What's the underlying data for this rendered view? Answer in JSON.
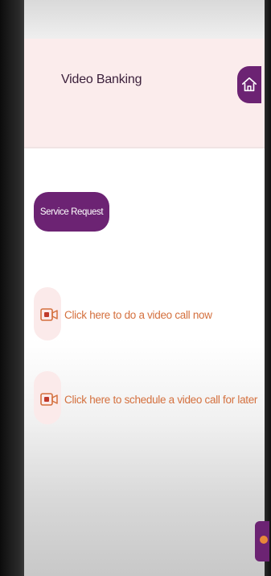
{
  "header": {
    "title": "Video Banking",
    "home_icon": "home-icon"
  },
  "service_request": {
    "label": "Service Request"
  },
  "actions": [
    {
      "label": "Click here to do a video call now",
      "icon": "video-camera-icon"
    },
    {
      "label": "Click here to schedule a video call for later",
      "icon": "video-camera-icon"
    }
  ],
  "colors": {
    "brand_purple": "#6c2373",
    "action_orange": "#d4703e",
    "header_bg": "#fbecec",
    "icon_bg": "#fbeaea"
  }
}
